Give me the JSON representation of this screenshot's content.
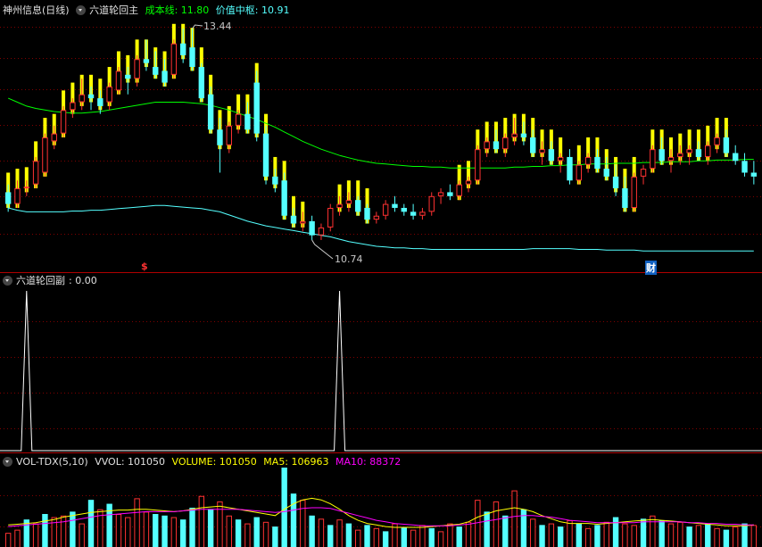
{
  "main_header": {
    "stock": "神州信息(日线)",
    "indicator": "六道轮回主",
    "cost_label": "成本线: 11.80",
    "value_label": "价值中枢: 10.91"
  },
  "annotations": {
    "high": "13.44",
    "low": "10.74",
    "marker_left": "$",
    "marker_right": "财"
  },
  "sub1_header": {
    "indicator": "六道轮回副",
    "value": ": 0.00"
  },
  "sub2_header": {
    "name": "VOL-TDX(5,10)",
    "vvol": "VVOL: 101050",
    "volume": "VOLUME: 101050",
    "ma5": "MA5: 106963",
    "ma10": "MA10: 88372"
  },
  "colors": {
    "up": "#ff3232",
    "down": "#54ffff",
    "yellow_bar": "#ffff00",
    "cost_line": "#00ff00",
    "value_line": "#54ffff",
    "grid": "#800000",
    "ma5": "#ffff00",
    "ma10": "#ff00ff"
  },
  "chart_data": {
    "type": "candlestick",
    "price_range": [
      10.5,
      13.6
    ],
    "candles": [
      [
        11.35,
        11.45,
        11.1,
        11.2
      ],
      [
        11.2,
        11.5,
        11.15,
        11.4
      ],
      [
        11.4,
        11.5,
        11.3,
        11.42
      ],
      [
        11.45,
        11.8,
        11.4,
        11.75
      ],
      [
        11.6,
        12.1,
        11.55,
        12.05
      ],
      [
        12.0,
        12.2,
        11.9,
        12.1
      ],
      [
        12.1,
        12.45,
        12.05,
        12.4
      ],
      [
        12.4,
        12.55,
        12.3,
        12.5
      ],
      [
        12.5,
        12.8,
        12.4,
        12.6
      ],
      [
        12.6,
        12.7,
        12.4,
        12.55
      ],
      [
        12.55,
        12.65,
        12.35,
        12.45
      ],
      [
        12.5,
        12.75,
        12.4,
        12.7
      ],
      [
        12.65,
        12.95,
        12.6,
        12.9
      ],
      [
        12.85,
        12.95,
        12.6,
        12.8
      ],
      [
        12.8,
        13.1,
        12.7,
        13.05
      ],
      [
        13.05,
        13.3,
        12.9,
        13.0
      ],
      [
        12.95,
        13.15,
        12.8,
        12.85
      ],
      [
        12.9,
        13.05,
        12.7,
        12.75
      ],
      [
        12.85,
        13.3,
        12.8,
        13.25
      ],
      [
        13.25,
        13.44,
        13.0,
        13.1
      ],
      [
        13.2,
        13.44,
        12.9,
        12.95
      ],
      [
        12.95,
        13.0,
        12.5,
        12.55
      ],
      [
        12.6,
        12.7,
        12.1,
        12.15
      ],
      [
        12.15,
        12.3,
        11.6,
        11.95
      ],
      [
        11.95,
        12.25,
        11.85,
        12.2
      ],
      [
        12.2,
        12.4,
        12.1,
        12.35
      ],
      [
        12.35,
        12.5,
        12.1,
        12.15
      ],
      [
        12.75,
        12.9,
        12.0,
        12.1
      ],
      [
        12.1,
        12.2,
        11.45,
        11.55
      ],
      [
        11.55,
        11.65,
        11.35,
        11.45
      ],
      [
        11.5,
        11.6,
        11.0,
        11.05
      ],
      [
        11.05,
        11.15,
        10.9,
        10.95
      ],
      [
        10.95,
        11.1,
        10.85,
        10.98
      ],
      [
        10.98,
        11.05,
        10.74,
        10.8
      ],
      [
        10.8,
        10.95,
        10.74,
        10.9
      ],
      [
        10.9,
        11.2,
        10.85,
        11.15
      ],
      [
        11.15,
        11.3,
        11.05,
        11.2
      ],
      [
        11.2,
        11.35,
        11.1,
        11.25
      ],
      [
        11.25,
        11.3,
        11.05,
        11.1
      ],
      [
        11.15,
        11.2,
        10.95,
        11.0
      ],
      [
        11.0,
        11.1,
        10.95,
        11.05
      ],
      [
        11.05,
        11.25,
        11.0,
        11.2
      ],
      [
        11.2,
        11.3,
        11.1,
        11.15
      ],
      [
        11.15,
        11.2,
        11.05,
        11.1
      ],
      [
        11.1,
        11.2,
        11.0,
        11.05
      ],
      [
        11.05,
        11.15,
        11.0,
        11.1
      ],
      [
        11.1,
        11.35,
        11.05,
        11.3
      ],
      [
        11.3,
        11.4,
        11.2,
        11.35
      ],
      [
        11.35,
        11.45,
        11.25,
        11.3
      ],
      [
        11.3,
        11.5,
        11.25,
        11.45
      ],
      [
        11.45,
        11.55,
        11.35,
        11.5
      ],
      [
        11.5,
        11.95,
        11.45,
        11.9
      ],
      [
        11.9,
        12.05,
        11.8,
        12.0
      ],
      [
        12.0,
        12.15,
        11.85,
        11.9
      ],
      [
        11.9,
        12.1,
        11.8,
        12.05
      ],
      [
        12.05,
        12.3,
        11.95,
        12.1
      ],
      [
        12.1,
        12.25,
        11.95,
        12.05
      ],
      [
        12.05,
        12.15,
        11.8,
        11.85
      ],
      [
        11.85,
        12.0,
        11.7,
        11.9
      ],
      [
        11.9,
        12.0,
        11.7,
        11.75
      ],
      [
        11.75,
        11.85,
        11.6,
        11.8
      ],
      [
        11.8,
        11.9,
        11.45,
        11.5
      ],
      [
        11.5,
        11.75,
        11.45,
        11.7
      ],
      [
        11.7,
        11.85,
        11.6,
        11.8
      ],
      [
        11.8,
        11.9,
        11.6,
        11.65
      ],
      [
        11.65,
        11.8,
        11.5,
        11.55
      ],
      [
        11.55,
        11.7,
        11.3,
        11.4
      ],
      [
        11.4,
        11.55,
        11.1,
        11.15
      ],
      [
        11.15,
        11.6,
        11.1,
        11.55
      ],
      [
        11.55,
        11.7,
        11.45,
        11.65
      ],
      [
        11.65,
        11.95,
        11.6,
        11.9
      ],
      [
        11.9,
        12.05,
        11.7,
        11.75
      ],
      [
        11.75,
        11.9,
        11.6,
        11.8
      ],
      [
        11.8,
        11.95,
        11.7,
        11.85
      ],
      [
        11.85,
        11.95,
        11.7,
        11.9
      ],
      [
        11.9,
        12.0,
        11.75,
        11.8
      ],
      [
        11.8,
        12.0,
        11.7,
        11.95
      ],
      [
        11.95,
        12.1,
        11.85,
        12.05
      ],
      [
        12.05,
        12.15,
        11.8,
        11.85
      ],
      [
        11.85,
        11.95,
        11.7,
        11.75
      ],
      [
        11.75,
        11.85,
        11.55,
        11.6
      ],
      [
        11.6,
        11.75,
        11.45,
        11.55
      ]
    ],
    "yellow_bars": [
      0,
      1,
      2,
      3,
      4,
      5,
      6,
      7,
      8,
      9,
      10,
      11,
      12,
      13,
      14,
      15,
      16,
      17,
      18,
      19,
      20,
      21,
      22,
      23,
      24,
      25,
      26,
      27,
      28,
      29,
      30,
      31,
      32,
      36,
      37,
      38,
      39,
      49,
      50,
      51,
      52,
      53,
      54,
      55,
      56,
      57,
      58,
      59,
      60,
      62,
      63,
      64,
      65,
      66,
      67,
      68,
      70,
      71,
      72,
      73,
      74,
      75,
      76,
      77,
      78
    ],
    "cost_line": [
      12.55,
      12.5,
      12.45,
      12.42,
      12.4,
      12.38,
      12.37,
      12.36,
      12.36,
      12.37,
      12.38,
      12.4,
      12.42,
      12.44,
      12.46,
      12.48,
      12.5,
      12.5,
      12.5,
      12.5,
      12.49,
      12.48,
      12.46,
      12.43,
      12.4,
      12.36,
      12.32,
      12.28,
      12.23,
      12.18,
      12.12,
      12.06,
      12.0,
      11.95,
      11.9,
      11.86,
      11.82,
      11.79,
      11.76,
      11.74,
      11.72,
      11.71,
      11.7,
      11.69,
      11.68,
      11.68,
      11.67,
      11.67,
      11.66,
      11.66,
      11.66,
      11.66,
      11.66,
      11.66,
      11.66,
      11.67,
      11.67,
      11.68,
      11.68,
      11.69,
      11.69,
      11.7,
      11.7,
      11.71,
      11.71,
      11.71,
      11.72,
      11.72,
      11.72,
      11.73,
      11.73,
      11.73,
      11.74,
      11.74,
      11.74,
      11.75,
      11.75,
      11.76,
      11.76,
      11.76,
      11.77,
      11.77
    ],
    "value_line": [
      11.15,
      11.12,
      11.1,
      11.1,
      11.1,
      11.1,
      11.1,
      11.11,
      11.11,
      11.12,
      11.12,
      11.13,
      11.14,
      11.15,
      11.16,
      11.17,
      11.18,
      11.18,
      11.17,
      11.16,
      11.15,
      11.14,
      11.12,
      11.1,
      11.06,
      11.02,
      10.98,
      10.95,
      10.92,
      10.9,
      10.88,
      10.86,
      10.84,
      10.82,
      10.8,
      10.78,
      10.75,
      10.72,
      10.7,
      10.68,
      10.66,
      10.65,
      10.64,
      10.64,
      10.63,
      10.63,
      10.62,
      10.62,
      10.62,
      10.62,
      10.62,
      10.62,
      10.62,
      10.62,
      10.62,
      10.62,
      10.62,
      10.63,
      10.63,
      10.63,
      10.63,
      10.63,
      10.62,
      10.62,
      10.62,
      10.61,
      10.61,
      10.61,
      10.61,
      10.6,
      10.6,
      10.6,
      10.6,
      10.6,
      10.6,
      10.6,
      10.6,
      10.6,
      10.6,
      10.6,
      10.6,
      10.6
    ],
    "signal_spikes": [
      2,
      36
    ],
    "volume_range": [
      0,
      101050
    ],
    "volume": [
      [
        18000,
        1
      ],
      [
        22000,
        1
      ],
      [
        35000,
        0
      ],
      [
        30000,
        1
      ],
      [
        42000,
        0
      ],
      [
        38000,
        1
      ],
      [
        40000,
        1
      ],
      [
        45000,
        0
      ],
      [
        30000,
        1
      ],
      [
        60000,
        0
      ],
      [
        48000,
        1
      ],
      [
        55000,
        0
      ],
      [
        42000,
        1
      ],
      [
        38000,
        1
      ],
      [
        62000,
        1
      ],
      [
        45000,
        1
      ],
      [
        42000,
        0
      ],
      [
        40000,
        0
      ],
      [
        38000,
        1
      ],
      [
        35000,
        0
      ],
      [
        50000,
        0
      ],
      [
        65000,
        1
      ],
      [
        48000,
        0
      ],
      [
        58000,
        1
      ],
      [
        40000,
        1
      ],
      [
        35000,
        0
      ],
      [
        30000,
        1
      ],
      [
        38000,
        0
      ],
      [
        32000,
        1
      ],
      [
        26000,
        0
      ],
      [
        101050,
        0
      ],
      [
        68000,
        0
      ],
      [
        60000,
        1
      ],
      [
        40000,
        0
      ],
      [
        36000,
        1
      ],
      [
        28000,
        0
      ],
      [
        35000,
        1
      ],
      [
        30000,
        0
      ],
      [
        22000,
        1
      ],
      [
        28000,
        0
      ],
      [
        24000,
        1
      ],
      [
        20000,
        0
      ],
      [
        30000,
        1
      ],
      [
        25000,
        0
      ],
      [
        22000,
        1
      ],
      [
        28000,
        1
      ],
      [
        24000,
        0
      ],
      [
        20000,
        1
      ],
      [
        30000,
        1
      ],
      [
        26000,
        0
      ],
      [
        32000,
        1
      ],
      [
        60000,
        1
      ],
      [
        45000,
        0
      ],
      [
        58000,
        1
      ],
      [
        40000,
        0
      ],
      [
        72000,
        1
      ],
      [
        48000,
        0
      ],
      [
        36000,
        1
      ],
      [
        28000,
        0
      ],
      [
        30000,
        1
      ],
      [
        26000,
        0
      ],
      [
        34000,
        1
      ],
      [
        30000,
        0
      ],
      [
        24000,
        1
      ],
      [
        28000,
        0
      ],
      [
        32000,
        1
      ],
      [
        38000,
        0
      ],
      [
        30000,
        1
      ],
      [
        28000,
        1
      ],
      [
        36000,
        0
      ],
      [
        40000,
        1
      ],
      [
        34000,
        0
      ],
      [
        30000,
        1
      ],
      [
        32000,
        1
      ],
      [
        26000,
        0
      ],
      [
        28000,
        1
      ],
      [
        30000,
        0
      ],
      [
        24000,
        1
      ],
      [
        22000,
        0
      ],
      [
        26000,
        1
      ],
      [
        30000,
        0
      ],
      [
        28000,
        1
      ]
    ],
    "ma5": [
      28000,
      29000,
      30000,
      31000,
      33000,
      35000,
      38000,
      40000,
      42000,
      44000,
      45000,
      46000,
      47000,
      47000,
      48000,
      48000,
      47000,
      46000,
      45000,
      46000,
      48000,
      50000,
      51000,
      52000,
      50000,
      48000,
      46000,
      44000,
      42000,
      40000,
      48000,
      55000,
      60000,
      62000,
      60000,
      55000,
      48000,
      40000,
      34000,
      30000,
      28000,
      26000,
      25000,
      25000,
      25000,
      25000,
      26000,
      27000,
      28000,
      29000,
      32000,
      38000,
      42000,
      46000,
      48000,
      50000,
      48000,
      45000,
      40000,
      36000,
      32000,
      30000,
      30000,
      30000,
      29000,
      30000,
      31000,
      32000,
      33000,
      34000,
      35000,
      34000,
      33000,
      32000,
      31000,
      30000,
      29000,
      28000,
      27000,
      27000,
      27000,
      28000
    ],
    "ma10": [
      26000,
      27000,
      28000,
      29000,
      30000,
      31000,
      32000,
      34000,
      36000,
      38000,
      40000,
      41000,
      42000,
      43000,
      44000,
      45000,
      45000,
      45000,
      45000,
      46000,
      47000,
      48000,
      48000,
      48000,
      48000,
      48000,
      47000,
      46000,
      45000,
      44000,
      45000,
      47000,
      49000,
      50000,
      50000,
      49000,
      46000,
      43000,
      40000,
      37000,
      34000,
      32000,
      30000,
      29000,
      28000,
      27000,
      27000,
      27000,
      27000,
      28000,
      29000,
      31000,
      33000,
      35000,
      37000,
      39000,
      40000,
      40000,
      39000,
      38000,
      36000,
      34000,
      33000,
      32000,
      31000,
      31000,
      31000,
      31000,
      31000,
      32000,
      32000,
      32000,
      32000,
      32000,
      31000,
      31000,
      30000,
      30000,
      29000,
      29000,
      28000,
      28000
    ]
  }
}
